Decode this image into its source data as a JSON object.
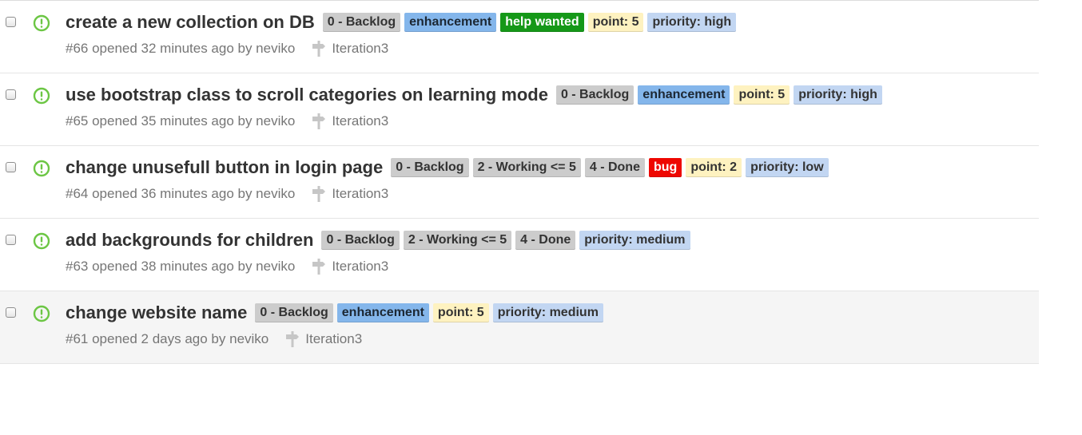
{
  "colors": {
    "open_status": "#6cc644",
    "backlog": "#cccccc",
    "enhancement": "#84b6eb",
    "help_wanted": "#159818",
    "point": "#fef2c0",
    "priority": "#c2d6f2",
    "bug": "#ee0701"
  },
  "issues": [
    {
      "title": "create a new collection on DB",
      "labels": [
        {
          "text": "0 - Backlog",
          "bg": "#cccccc",
          "fg": "#333333"
        },
        {
          "text": "enhancement",
          "bg": "#84b6eb",
          "fg": "#1c2733"
        },
        {
          "text": "help wanted",
          "bg": "#159818",
          "fg": "#ffffff"
        },
        {
          "text": "point: 5",
          "bg": "#fef2c0",
          "fg": "#333333"
        },
        {
          "text": "priority: high",
          "bg": "#c2d6f2",
          "fg": "#333333"
        }
      ],
      "meta": "#66 opened 32 minutes ago by neviko",
      "milestone": "Iteration3",
      "icon": "open-issue-icon"
    },
    {
      "title": "use bootstrap class to scroll categories on learning mode",
      "labels": [
        {
          "text": "0 - Backlog",
          "bg": "#cccccc",
          "fg": "#333333"
        },
        {
          "text": "enhancement",
          "bg": "#84b6eb",
          "fg": "#1c2733"
        },
        {
          "text": "point: 5",
          "bg": "#fef2c0",
          "fg": "#333333"
        },
        {
          "text": "priority: high",
          "bg": "#c2d6f2",
          "fg": "#333333"
        }
      ],
      "meta": "#65 opened 35 minutes ago by neviko",
      "milestone": "Iteration3",
      "icon": "open-issue-icon"
    },
    {
      "title": "change unusefull button in login page",
      "labels": [
        {
          "text": "0 - Backlog",
          "bg": "#cccccc",
          "fg": "#333333"
        },
        {
          "text": "2 - Working <= 5",
          "bg": "#cccccc",
          "fg": "#333333"
        },
        {
          "text": "4 - Done",
          "bg": "#cccccc",
          "fg": "#333333"
        },
        {
          "text": "bug",
          "bg": "#ee0701",
          "fg": "#ffffff"
        },
        {
          "text": "point: 2",
          "bg": "#fef2c0",
          "fg": "#333333"
        },
        {
          "text": "priority: low",
          "bg": "#c2d6f2",
          "fg": "#333333"
        }
      ],
      "meta": "#64 opened 36 minutes ago by neviko",
      "milestone": "Iteration3",
      "icon": "open-issue-icon"
    },
    {
      "title": "add backgrounds for children",
      "labels": [
        {
          "text": "0 - Backlog",
          "bg": "#cccccc",
          "fg": "#333333"
        },
        {
          "text": "2 - Working <= 5",
          "bg": "#cccccc",
          "fg": "#333333"
        },
        {
          "text": "4 - Done",
          "bg": "#cccccc",
          "fg": "#333333"
        },
        {
          "text": "priority: medium",
          "bg": "#c2d6f2",
          "fg": "#333333"
        }
      ],
      "meta": "#63 opened 38 minutes ago by neviko",
      "milestone": "Iteration3",
      "icon": "open-issue-icon"
    },
    {
      "title": "change website name",
      "labels": [
        {
          "text": "0 - Backlog",
          "bg": "#cccccc",
          "fg": "#333333"
        },
        {
          "text": "enhancement",
          "bg": "#84b6eb",
          "fg": "#1c2733"
        },
        {
          "text": "point: 5",
          "bg": "#fef2c0",
          "fg": "#333333"
        },
        {
          "text": "priority: medium",
          "bg": "#c2d6f2",
          "fg": "#333333"
        }
      ],
      "meta": "#61 opened 2 days ago by neviko",
      "milestone": "Iteration3",
      "icon": "open-issue-icon",
      "highlighted": true
    }
  ]
}
